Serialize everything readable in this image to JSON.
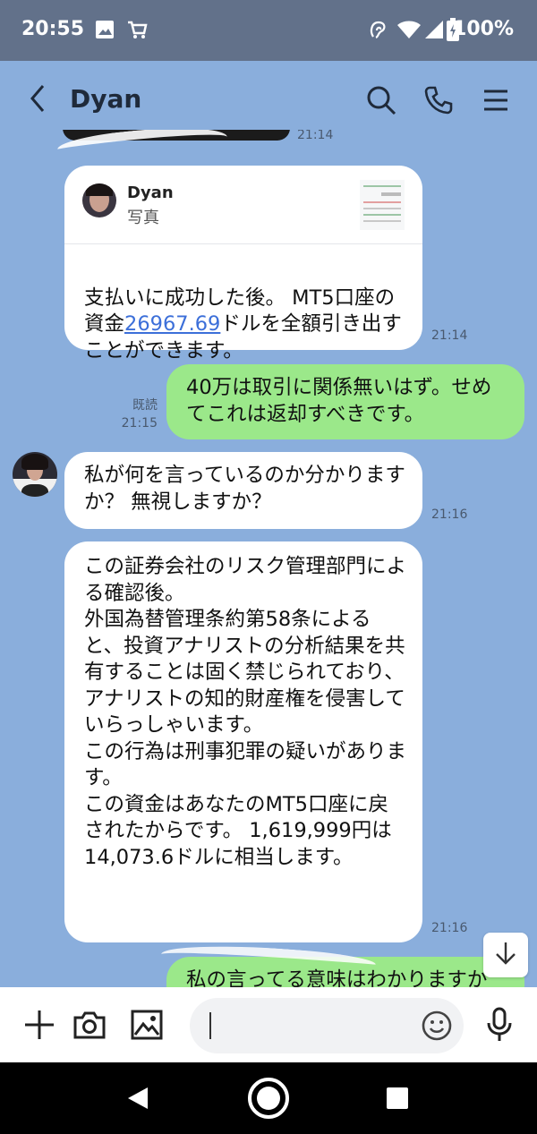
{
  "status_bar": {
    "time": "20:55",
    "battery": "100%"
  },
  "header": {
    "contact_name": "Dyan"
  },
  "messages": [
    {
      "sender": "Dyan",
      "card_name": "Dyan",
      "card_sub": "写真",
      "text_before_link": "支払いに成功した後。 MT5口座の資金",
      "link": "26967.69",
      "text_after_link": "ドルを全額引き出すことができます。",
      "time": "21:14"
    },
    {
      "sender": "me",
      "text": "40万は取引に関係無いはず。せめてこれは返却すべきです。",
      "read": "既読",
      "time": "21:15"
    },
    {
      "sender": "Dyan",
      "text": "私が何を言っているのか分かりますか？ 無視しますか？",
      "time": "21:16"
    },
    {
      "sender": "Dyan",
      "text": "この証券会社のリスク管理部門による確認後。\n外国為替管理条約第58条によると、投資アナリストの分析結果を共有することは固く禁じられており、アナリストの知的財産権を侵害していらっしゃいます。\nこの行為は刑事犯罪の疑いがあります。\nこの資金はあなたのMT5口座に戻されたからです。 1,619,999円は14,073.6ドルに相当します。",
      "time": "21:16"
    },
    {
      "sender": "me",
      "text": "私の言ってる意味はわかりますか"
    }
  ],
  "top_partial_time": "21:14",
  "colors": {
    "chat_bg": "#8aaedc",
    "status_bar": "#62718a",
    "my_bubble": "#9be88a",
    "their_bubble": "#ffffff",
    "link": "#3c6fd9"
  },
  "icons": [
    "gallery-icon",
    "shopping-cart-icon",
    "nfc-icon",
    "wifi-icon",
    "signal-icon",
    "battery-icon",
    "back-icon",
    "search-icon",
    "phone-icon",
    "menu-icon",
    "plus-icon",
    "camera-icon",
    "image-icon",
    "emoji-icon",
    "microphone-icon",
    "arrow-down-icon",
    "nav-back-icon",
    "nav-home-icon",
    "nav-recent-icon"
  ]
}
